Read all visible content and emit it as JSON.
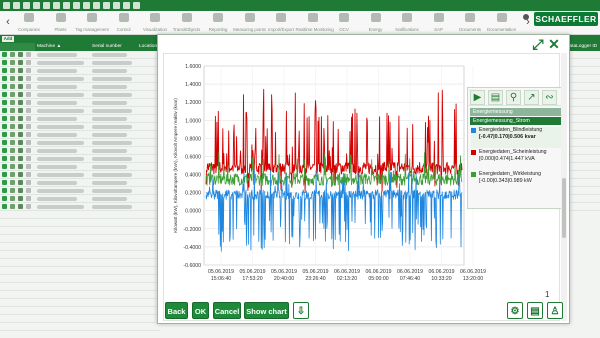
{
  "brand": {
    "logo_text": "SCHAEFFLER",
    "accent": "#1f7a35"
  },
  "navbar": {
    "items": [
      {
        "label": "Companies",
        "icon": "home-icon"
      },
      {
        "label": "Plants",
        "icon": "gear-icon"
      },
      {
        "label": "Tag management",
        "icon": "tag-icon"
      },
      {
        "label": "Control",
        "icon": "warning-icon"
      },
      {
        "label": "Visualization",
        "icon": "chart-icon"
      },
      {
        "label": "TransitObjects",
        "icon": "transit-icon"
      },
      {
        "label": "Reporting",
        "icon": "report-icon"
      },
      {
        "label": "Measuring points",
        "icon": "meter-icon"
      },
      {
        "label": "Import/Export",
        "icon": "import-icon"
      },
      {
        "label": "Realtime Monitoring",
        "icon": "monitor-icon"
      },
      {
        "label": "OCV",
        "icon": "doc-icon"
      },
      {
        "label": "Energy",
        "icon": "energy-icon"
      },
      {
        "label": "Notifications",
        "icon": "notification-icon"
      },
      {
        "label": "SAP",
        "icon": "sap-icon"
      },
      {
        "label": "Documents",
        "icon": "documents-icon"
      },
      {
        "label": "Documentation",
        "icon": "book-icon"
      }
    ]
  },
  "table": {
    "add_label": "Add",
    "headers": {
      "machine": "Machine ▲",
      "serial": "Serial number",
      "location": "Location",
      "extra": "DataLogger ID"
    },
    "row_count": 20
  },
  "modal": {
    "expand_icon": "expand-icon",
    "close_icon": "close-icon",
    "page_number": "1",
    "buttons": {
      "back": "Back",
      "ok": "OK",
      "cancel": "Cancel",
      "show_chart": "Show chart"
    },
    "panel": {
      "group_parent": "Energiemessung",
      "group_label": "Energiemessung_Strom",
      "legend": [
        {
          "name": "Energiedaten_Blindleistung",
          "value": "[-0.47|0.170|0.506 kvar",
          "color": "#1f86e0"
        },
        {
          "name": "Energiedaten_Scheinleistung",
          "value": "[0.000|0.474|1.447 kVA",
          "color": "#d40000"
        },
        {
          "name": "Energiedaten_Wirkleistung",
          "value": "[-0.00|0.343|0.989 kW",
          "color": "#3a9e32"
        }
      ]
    }
  },
  "chart_data": {
    "type": "line",
    "ylabel": "Kilowatt (kW), Kilovoltampere (kVA), Kilovolt Ampere reaktiv (kvar)",
    "ylim": [
      -0.6,
      1.6
    ],
    "yticks": [
      "1.6000",
      "1.4000",
      "1.2000",
      "1.0000",
      "0.8000",
      "0.6000",
      "0.4000",
      "0.2000",
      "0.0000",
      "-0.2000",
      "-0.4000",
      "-0.6000"
    ],
    "xticks": [
      [
        "05.06.2019",
        "15:06:40"
      ],
      [
        "05.06.2019",
        "17:53:20"
      ],
      [
        "05.06.2019",
        "20:40:00"
      ],
      [
        "05.06.2019",
        "23:26:40"
      ],
      [
        "06.06.2019",
        "02:13:20"
      ],
      [
        "06.06.2019",
        "05:00:00"
      ],
      [
        "06.06.2019",
        "07:46:40"
      ],
      [
        "06.06.2019",
        "10:33:20"
      ],
      [
        "06.06.2019",
        "13:20:00"
      ]
    ],
    "grid": true,
    "series": [
      {
        "name": "Energiedaten_Scheinleistung",
        "color": "#d40000",
        "baseline": 0.474,
        "max": 1.447,
        "min": 0.0
      },
      {
        "name": "Energiedaten_Wirkleistung",
        "color": "#3a9e32",
        "baseline": 0.343,
        "max": 0.989,
        "min": 0.0
      },
      {
        "name": "Energiedaten_Blindleistung",
        "color": "#1f86e0",
        "baseline": 0.17,
        "max": 0.506,
        "min": -0.47
      }
    ]
  }
}
